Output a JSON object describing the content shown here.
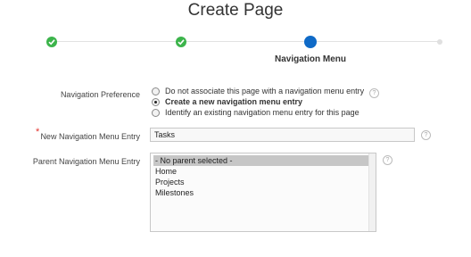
{
  "page": {
    "title": "Create Page"
  },
  "wizard": {
    "steps": [
      {
        "state": "done"
      },
      {
        "state": "done"
      },
      {
        "state": "current",
        "label": "Navigation Menu"
      },
      {
        "state": "upcoming"
      }
    ],
    "colors": {
      "done": "#3cb44b",
      "current": "#0f6ac7"
    }
  },
  "form": {
    "nav_pref": {
      "label": "Navigation Preference",
      "options": [
        "Do not associate this page with a navigation menu entry",
        "Create a new navigation menu entry",
        "Identify an existing navigation menu entry for this page"
      ],
      "selected_index": 1
    },
    "new_entry": {
      "label": "New Navigation Menu Entry",
      "value": "Tasks",
      "required": true
    },
    "parent_entry": {
      "label": "Parent Navigation Menu Entry",
      "options": [
        "- No parent selected -",
        "Home",
        "Projects",
        "Milestones"
      ],
      "selected_index": 0
    },
    "help_icon": "?"
  }
}
